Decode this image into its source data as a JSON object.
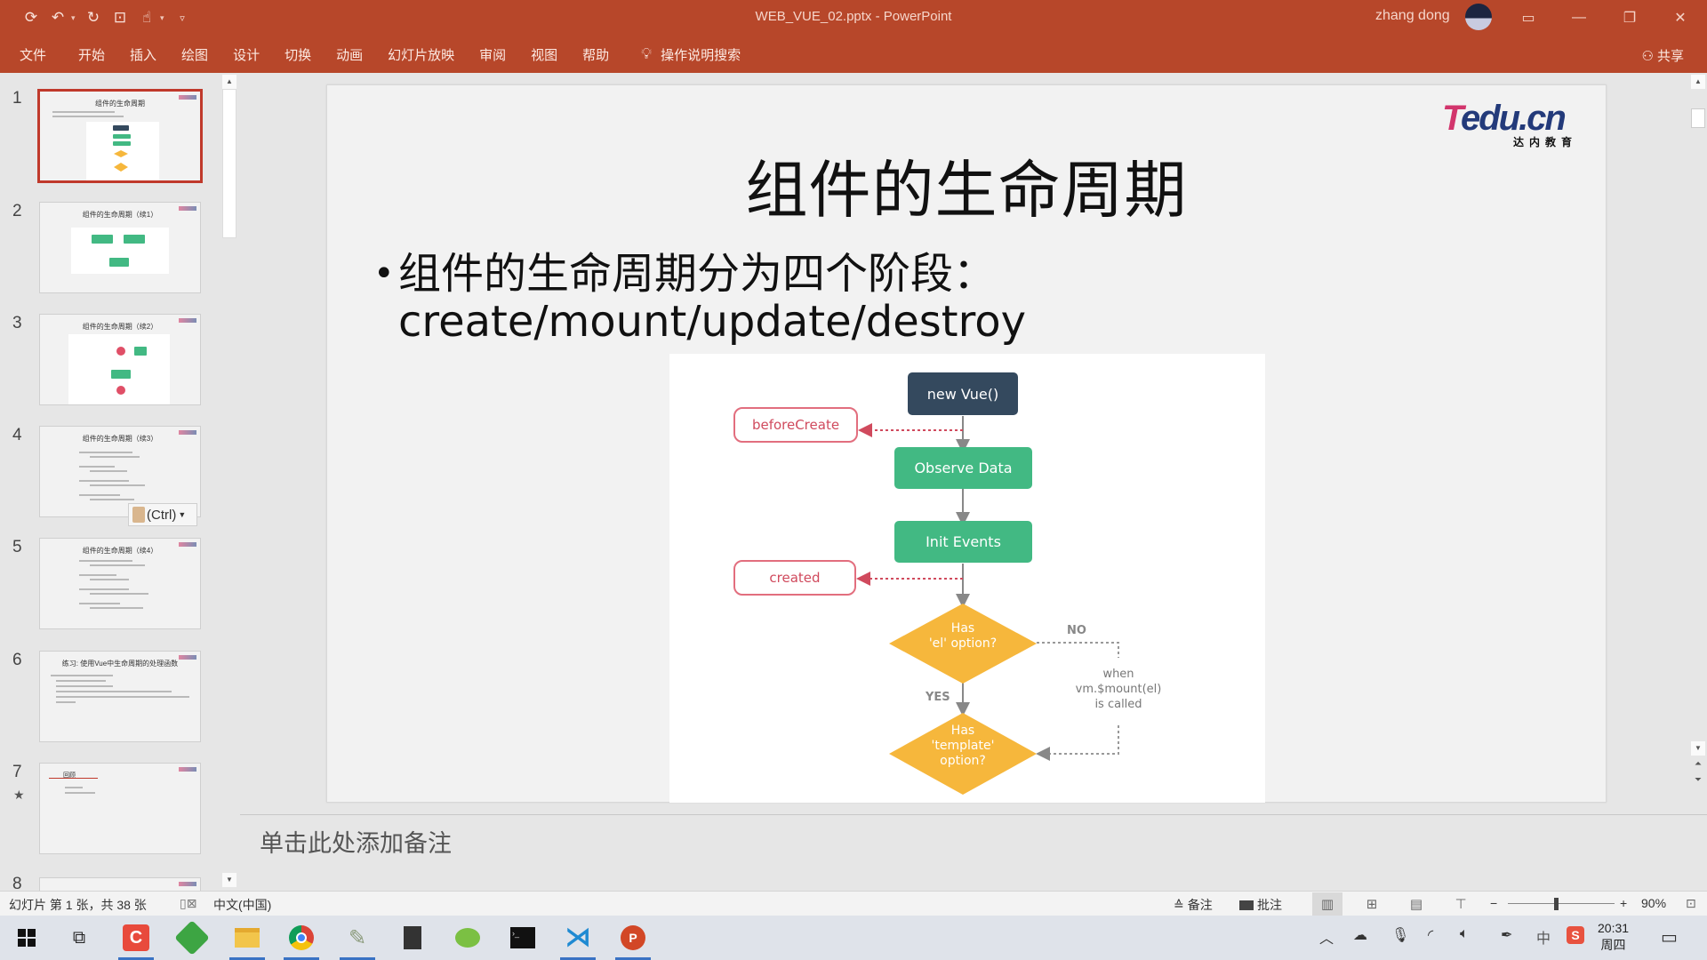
{
  "window": {
    "title": "WEB_VUE_02.pptx  -  PowerPoint",
    "user_name": "zhang dong",
    "share_label": "共享"
  },
  "quick_access": [
    {
      "name": "save-icon",
      "glyph": "🖫"
    },
    {
      "name": "undo-icon",
      "glyph": "↶"
    },
    {
      "name": "redo-icon",
      "glyph": "↻"
    },
    {
      "name": "presentation-icon",
      "glyph": "⊡"
    },
    {
      "name": "touch-mode-icon",
      "glyph": "☝"
    },
    {
      "name": "customize-icon",
      "glyph": "▿"
    }
  ],
  "ribbon": {
    "tabs": [
      "文件",
      "开始",
      "插入",
      "绘图",
      "设计",
      "切换",
      "动画",
      "幻灯片放映",
      "审阅",
      "视图",
      "帮助"
    ],
    "tell_me": "操作说明搜索"
  },
  "thumbnails": [
    {
      "num": "1",
      "title": "组件的生命周期",
      "selected": true
    },
    {
      "num": "2",
      "title": "组件的生命周期（续1）"
    },
    {
      "num": "3",
      "title": "组件的生命周期（续2）"
    },
    {
      "num": "4",
      "title": "组件的生命周期（续3）"
    },
    {
      "num": "5",
      "title": "组件的生命周期（续4）"
    },
    {
      "num": "6",
      "title": "练习: 使用Vue中生命周期的处理函数"
    },
    {
      "num": "7",
      "title": "回顾",
      "star": "★"
    },
    {
      "num": "8",
      "title": ""
    }
  ],
  "paste_options": "(Ctrl)",
  "slide": {
    "title": "组件的生命周期",
    "bullet_line1": "组件的生命周期分为四个阶段：",
    "bullet_line2": "create/mount/update/destroy",
    "logo_brand_t": "T",
    "logo_brand_rest": "edu.cn",
    "logo_sub": "达内教育",
    "diagram": {
      "new_vue": "new Vue()",
      "before_create": "beforeCreate",
      "observe_data": "Observe Data",
      "init_events": "Init Events",
      "created": "created",
      "has_el_line1": "Has",
      "has_el_line2": "'el' option?",
      "no": "NO",
      "yes": "YES",
      "when_line1": "when",
      "when_line2": "vm.$mount(el)",
      "when_line3": "is called",
      "has_template_line1": "Has",
      "has_template_line2": "'template'",
      "has_template_line3": "option?"
    }
  },
  "notes_placeholder": "单击此处添加备注",
  "statusbar": {
    "slide_info": "幻灯片 第 1 张，共 38 张",
    "language": "中文(中国)",
    "notes_btn": "备注",
    "comments_btn": "批注",
    "zoom_minus": "−",
    "zoom_plus": "+",
    "zoom_level": "90%",
    "zoom_fraction": 0.45
  },
  "taskbar": {
    "apps": [
      "start",
      "task-view",
      "app-c",
      "app-green",
      "file-explorer",
      "chrome",
      "app-feather",
      "app-notepad",
      "wechat",
      "terminal",
      "vscode",
      "powerpoint"
    ],
    "time": "20:31",
    "day": "周四",
    "ime": "中"
  },
  "colors": {
    "accent": "#b7472a",
    "vue_green": "#42b983",
    "vue_dark": "#34495e",
    "hook_red": "#e26e7e",
    "decision_yellow": "#f6b73c"
  }
}
